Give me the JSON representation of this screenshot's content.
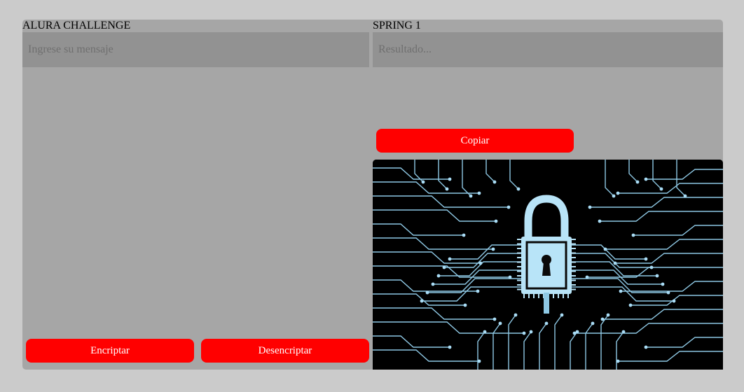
{
  "left_panel": {
    "title": "ALURA CHALLENGE",
    "input_placeholder": "Ingrese su mensaje",
    "input_value": "",
    "encrypt_label": "Encriptar",
    "decrypt_label": "Desencriptar"
  },
  "right_panel": {
    "title": "SPRING 1",
    "output_placeholder": "Resultado...",
    "output_value": "",
    "copy_label": "Copiar",
    "image_icon": "circuit-padlock-icon"
  },
  "colors": {
    "background": "#cbcbcb",
    "panel": "#a6a6a6",
    "field": "#929292",
    "button": "#ff0000",
    "circuit": "#a9dcf5"
  }
}
